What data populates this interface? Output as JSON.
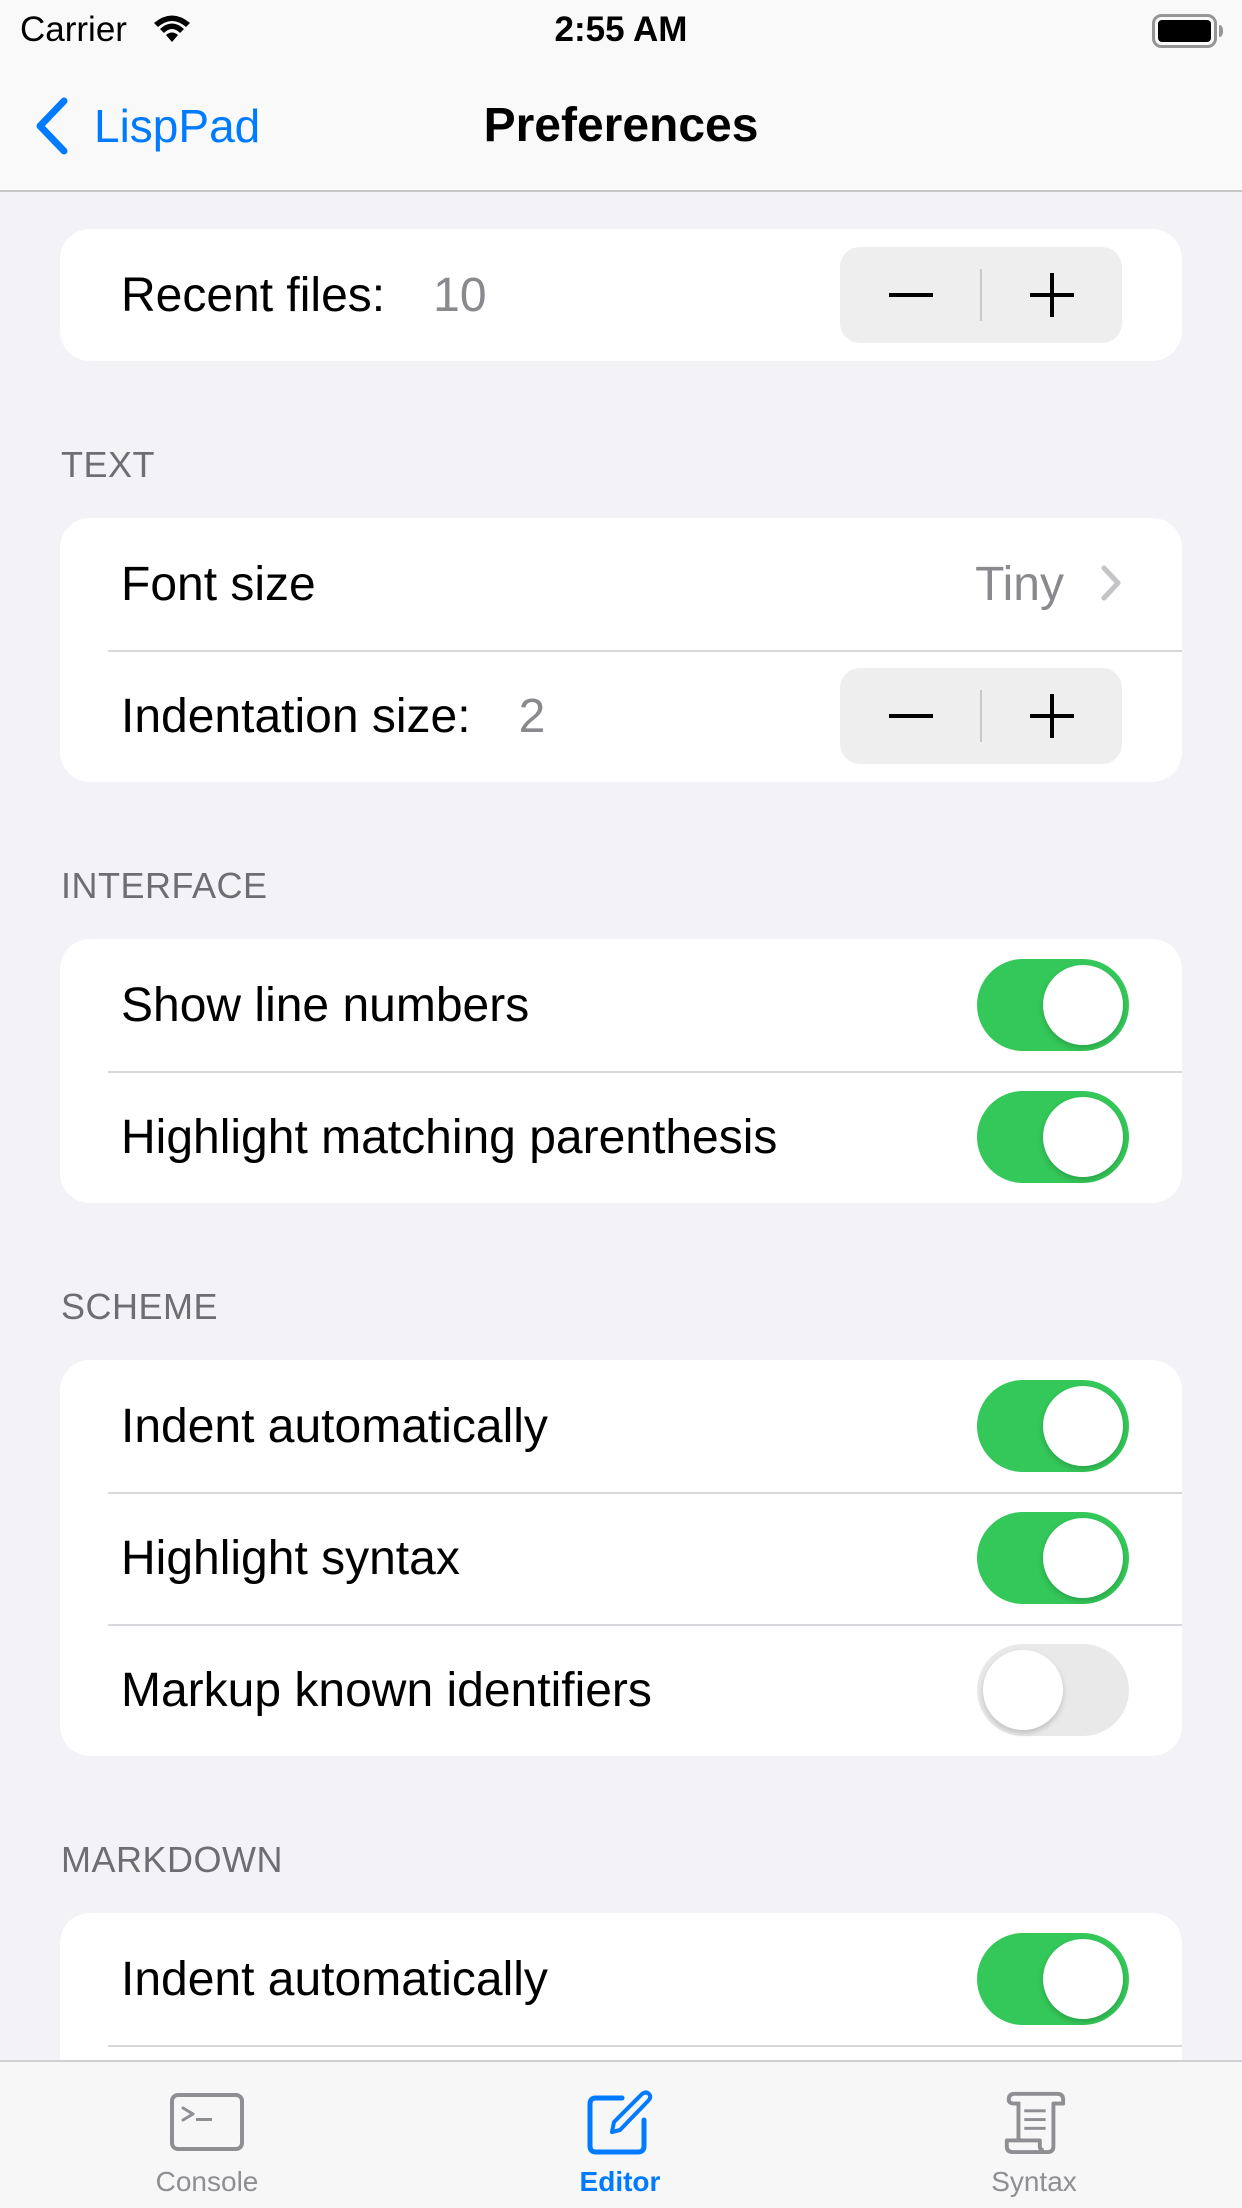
{
  "status_bar": {
    "carrier": "Carrier",
    "time": "2:55 AM",
    "wifi_icon": "wifi-icon",
    "battery_icon": "battery-icon"
  },
  "nav": {
    "back_label": "LispPad",
    "title": "Preferences"
  },
  "recent_files": {
    "label": "Recent files:",
    "value": "10"
  },
  "text_section": {
    "header": "TEXT",
    "font_size_label": "Font size",
    "font_size_value": "Tiny",
    "indentation_label": "Indentation size:",
    "indentation_value": "2"
  },
  "interface_section": {
    "header": "INTERFACE",
    "rows": [
      {
        "label": "Show line numbers",
        "on": true
      },
      {
        "label": "Highlight matching parenthesis",
        "on": true
      }
    ]
  },
  "scheme_section": {
    "header": "SCHEME",
    "rows": [
      {
        "label": "Indent automatically",
        "on": true
      },
      {
        "label": "Highlight syntax",
        "on": true
      },
      {
        "label": "Markup known identifiers",
        "on": false
      }
    ]
  },
  "markdown_section": {
    "header": "MARKDOWN",
    "rows": [
      {
        "label": "Indent automatically",
        "on": true
      }
    ]
  },
  "tabs": [
    {
      "label": "Console",
      "icon": "terminal-icon",
      "active": false
    },
    {
      "label": "Editor",
      "icon": "edit-icon",
      "active": true
    },
    {
      "label": "Syntax",
      "icon": "scroll-icon",
      "active": false
    }
  ],
  "colors": {
    "accent": "#007aff",
    "toggle_on": "#34c759",
    "toggle_off": "#e9e9ea",
    "background": "#f2f2f7"
  }
}
